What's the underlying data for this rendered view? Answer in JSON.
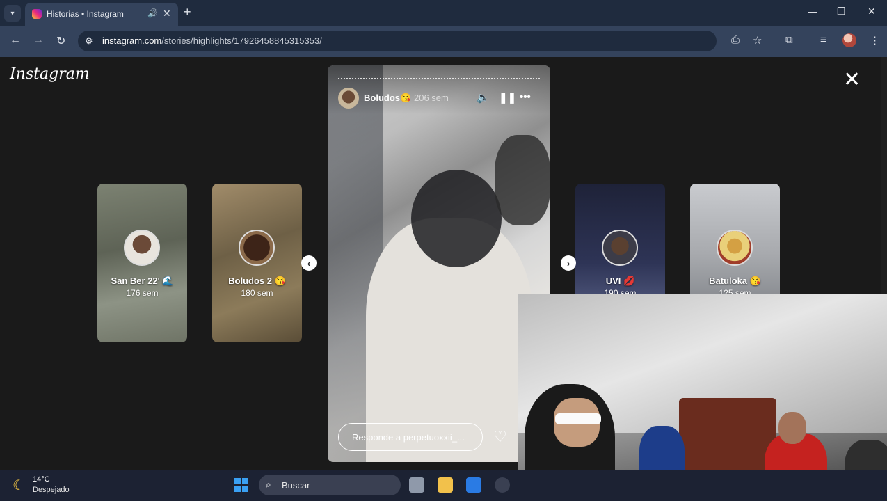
{
  "browser": {
    "tab_title": "Historias • Instagram",
    "url_host": "instagram.com",
    "url_path": "/stories/highlights/17926458845315353/",
    "new_tab": "+",
    "tab_close": "✕",
    "window": {
      "minimize": "—",
      "maximize": "❐",
      "close": "✕"
    }
  },
  "page": {
    "logo": "Instagram",
    "close": "✕"
  },
  "story_cards": [
    {
      "name": "San Ber 22' 🌊",
      "age": "176 sem"
    },
    {
      "name": "Boludos 2 😘",
      "age": "180 sem"
    },
    {
      "name": "UVI 💋",
      "age": "190 sem"
    },
    {
      "name": "Batuloka 😘",
      "age": "125 sem"
    }
  ],
  "story": {
    "author": "Boludos😘",
    "age": "206 sem",
    "reply_placeholder": "Responde a perpetuoxxii_..."
  },
  "nav_arrows": {
    "prev": "‹",
    "next": "›"
  },
  "taskbar": {
    "temp": "14°C",
    "weather": "Despejado",
    "search": "Buscar"
  }
}
